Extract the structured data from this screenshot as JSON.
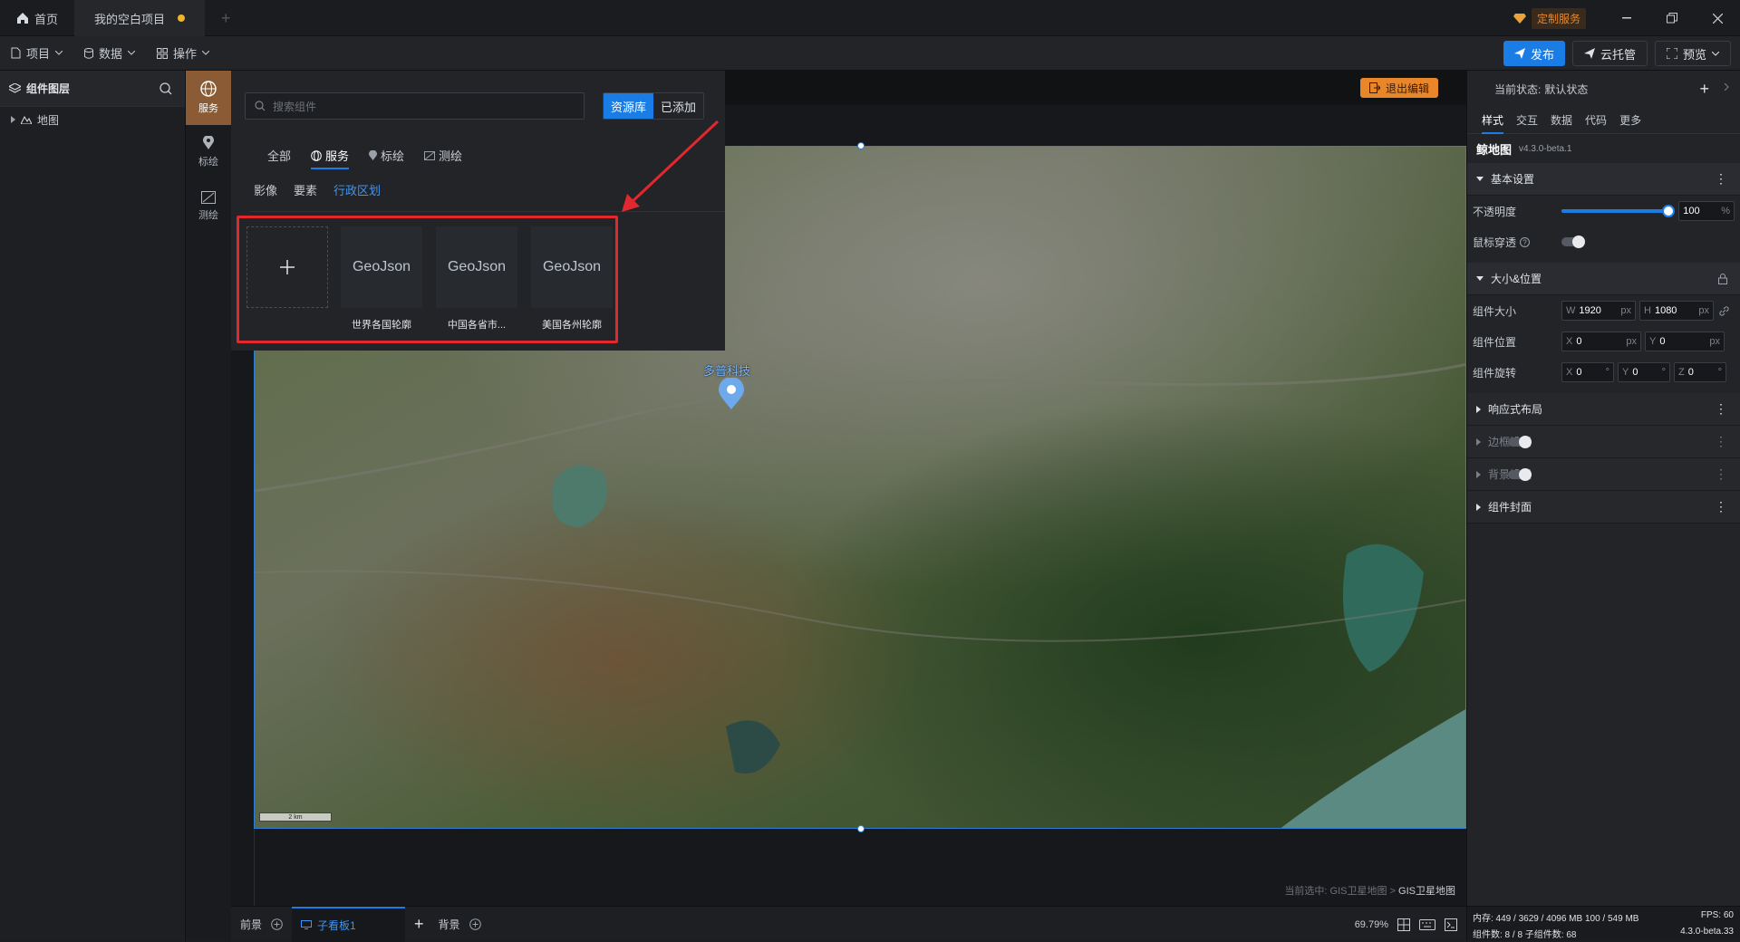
{
  "titlebar": {
    "tabs": [
      {
        "label": "首页",
        "icon": "home-icon"
      },
      {
        "label": "我的空白项目",
        "icon": ""
      }
    ],
    "custom_service": "定制服务"
  },
  "menubar": {
    "items": [
      {
        "label": "项目",
        "icon": "file-icon"
      },
      {
        "label": "数据",
        "icon": "database-icon"
      },
      {
        "label": "操作",
        "icon": "grid-icon"
      }
    ],
    "publish": "发布",
    "cloud": "云托管",
    "preview": "预览"
  },
  "layers": {
    "title": "组件图层",
    "items": [
      {
        "label": "地图"
      }
    ]
  },
  "toolrail": {
    "items": [
      {
        "label": "服务",
        "icon": "globe-icon"
      },
      {
        "label": "标绘",
        "icon": "pin-icon"
      },
      {
        "label": "测绘",
        "icon": "ruler-icon"
      }
    ]
  },
  "popup": {
    "search_placeholder": "搜索组件",
    "tab_library": "资源库",
    "tab_added": "已添加",
    "categories": [
      "全部",
      "服务",
      "标绘",
      "测绘"
    ],
    "subcategories": [
      "影像",
      "要素",
      "行政区划"
    ],
    "cards": [
      {
        "thumb": "GeoJson",
        "label": "世界各国轮廓"
      },
      {
        "thumb": "GeoJson",
        "label": "中国各省市..."
      },
      {
        "thumb": "GeoJson",
        "label": "美国各州轮廓"
      }
    ]
  },
  "canvas": {
    "exit_edit": "退出编辑",
    "map_marker_label": "多普科技",
    "scale_label": "2 km",
    "breadcrumb_prefix": "当前选中: GIS卫星地图 >",
    "breadcrumb_current": "GIS卫星地图"
  },
  "bottombar": {
    "tabs": [
      "前景",
      "子看板1",
      "背景"
    ],
    "zoom": "69.79%"
  },
  "props": {
    "state_label": "当前状态:",
    "state_value": "默认状态",
    "tabs": [
      "样式",
      "交互",
      "数据",
      "代码",
      "更多"
    ],
    "component_name": "鲸地图",
    "component_version": "v4.3.0-beta.1",
    "sections": {
      "basic": "基本设置",
      "size_pos": "大小&位置",
      "responsive": "响应式布局",
      "border": "边框设置",
      "background": "背景设置",
      "cover": "组件封面"
    },
    "opacity_label": "不透明度",
    "opacity_value": "100",
    "opacity_fraction": 1.0,
    "mouse_through_label": "鼠标穿透",
    "size_label": "组件大小",
    "width": "1920",
    "height": "1080",
    "pos_label": "组件位置",
    "pos_x": "0",
    "pos_y": "0",
    "rotate_label": "组件旋转",
    "rot_x": "0",
    "rot_y": "0",
    "rot_z": "0",
    "unit_px": "px",
    "unit_pct": "%",
    "unit_deg": "°"
  },
  "status": {
    "memory": "内存: 449 / 3629 / 4096 MB  100 / 549 MB",
    "fps": "FPS: 60",
    "components": "组件数: 8 / 8   子组件数: 68",
    "version": "4.3.0-beta.33"
  },
  "colors": {
    "accent": "#1a7de6",
    "highlight_box": "#e0282e",
    "rail_active": "#8a5b34",
    "exit_button": "#e8862a"
  }
}
